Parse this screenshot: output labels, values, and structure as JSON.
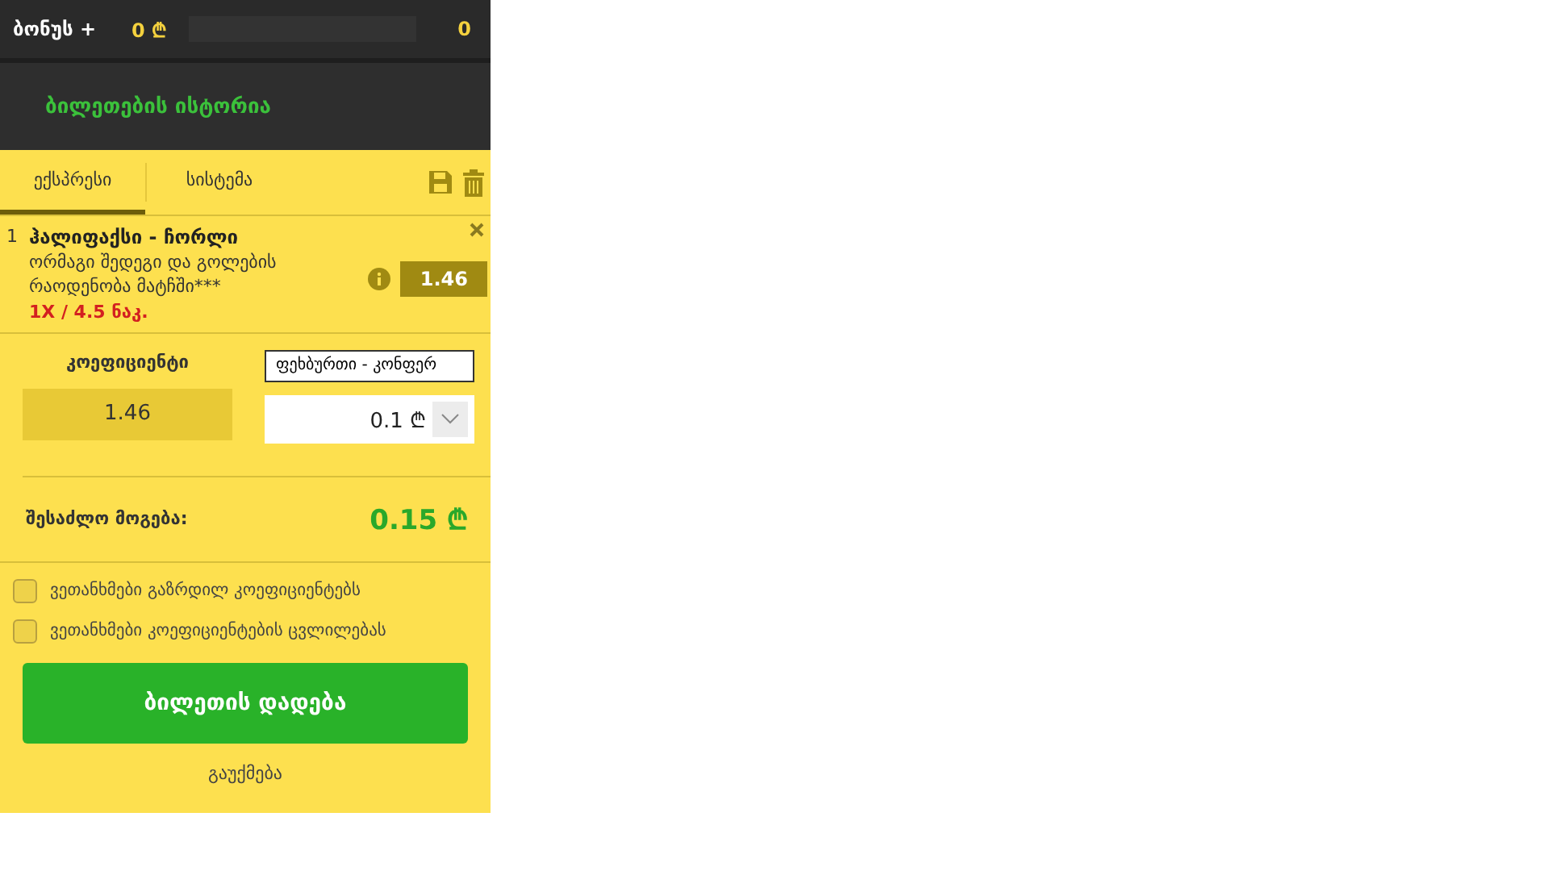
{
  "top_bar": {
    "bonus_label": "ბონუს +",
    "bonus_amount": "0 ₾",
    "count": "0"
  },
  "history_link": "ბილეთების ისტორია",
  "tabs": [
    {
      "label": "ექსპრესი",
      "selected": true
    },
    {
      "label": "სისტემა",
      "selected": false
    }
  ],
  "bets": [
    {
      "number": "1",
      "match": "ჰალიფაქსი - ჩორლი",
      "market": "ორმაგი შედეგი და გოლების რაოდენობა მატჩში***",
      "selection": "1X / 4.5 ნაკ.",
      "odds": "1.46"
    }
  ],
  "coefficient": {
    "label": "კოეფიციენტი",
    "value": "1.46"
  },
  "tooltip": "ფეხბურთი - კონფერ",
  "stake": {
    "value": "0.1 ₾"
  },
  "possible_win": {
    "label": "შესაძლო მოგება:",
    "value": "0.15 ₾"
  },
  "options": [
    {
      "label": "ვეთანხმები გაზრდილ კოეფიციენტებს",
      "checked": false
    },
    {
      "label": "ვეთანხმები კოეფიციენტების ცვლილებას",
      "checked": false
    }
  ],
  "place_button": "ბილეთის დადება",
  "cancel": "გაუქმება"
}
